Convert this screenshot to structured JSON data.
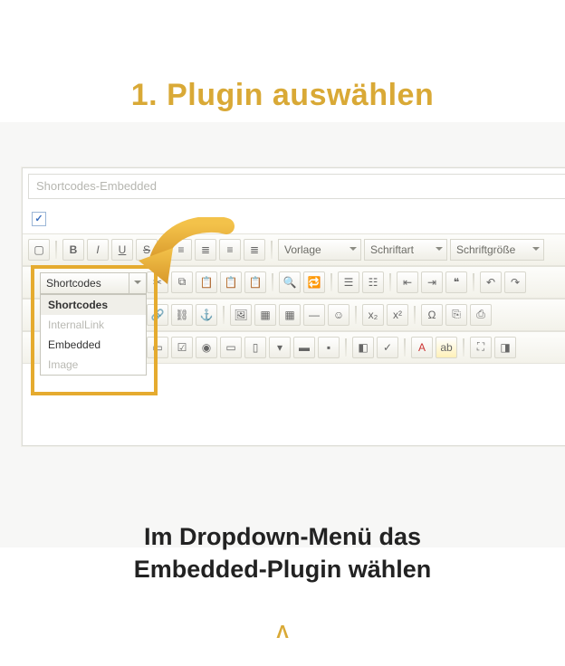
{
  "title": "1. Plugin auswählen",
  "caption_line1": "Im Dropdown-Menü das",
  "caption_line2": "Embedded-Plugin wählen",
  "logo_glyph": "Λ",
  "editor": {
    "path_value": "Shortcodes-Embedded",
    "check_glyph": "✓",
    "sel_template": "Vorlage",
    "sel_font": "Schriftart",
    "sel_size": "Schriftgröße",
    "dd_label": "Shortcodes",
    "dd_items": [
      "Shortcodes",
      "InternalLink",
      "Embedded",
      "Image"
    ]
  }
}
